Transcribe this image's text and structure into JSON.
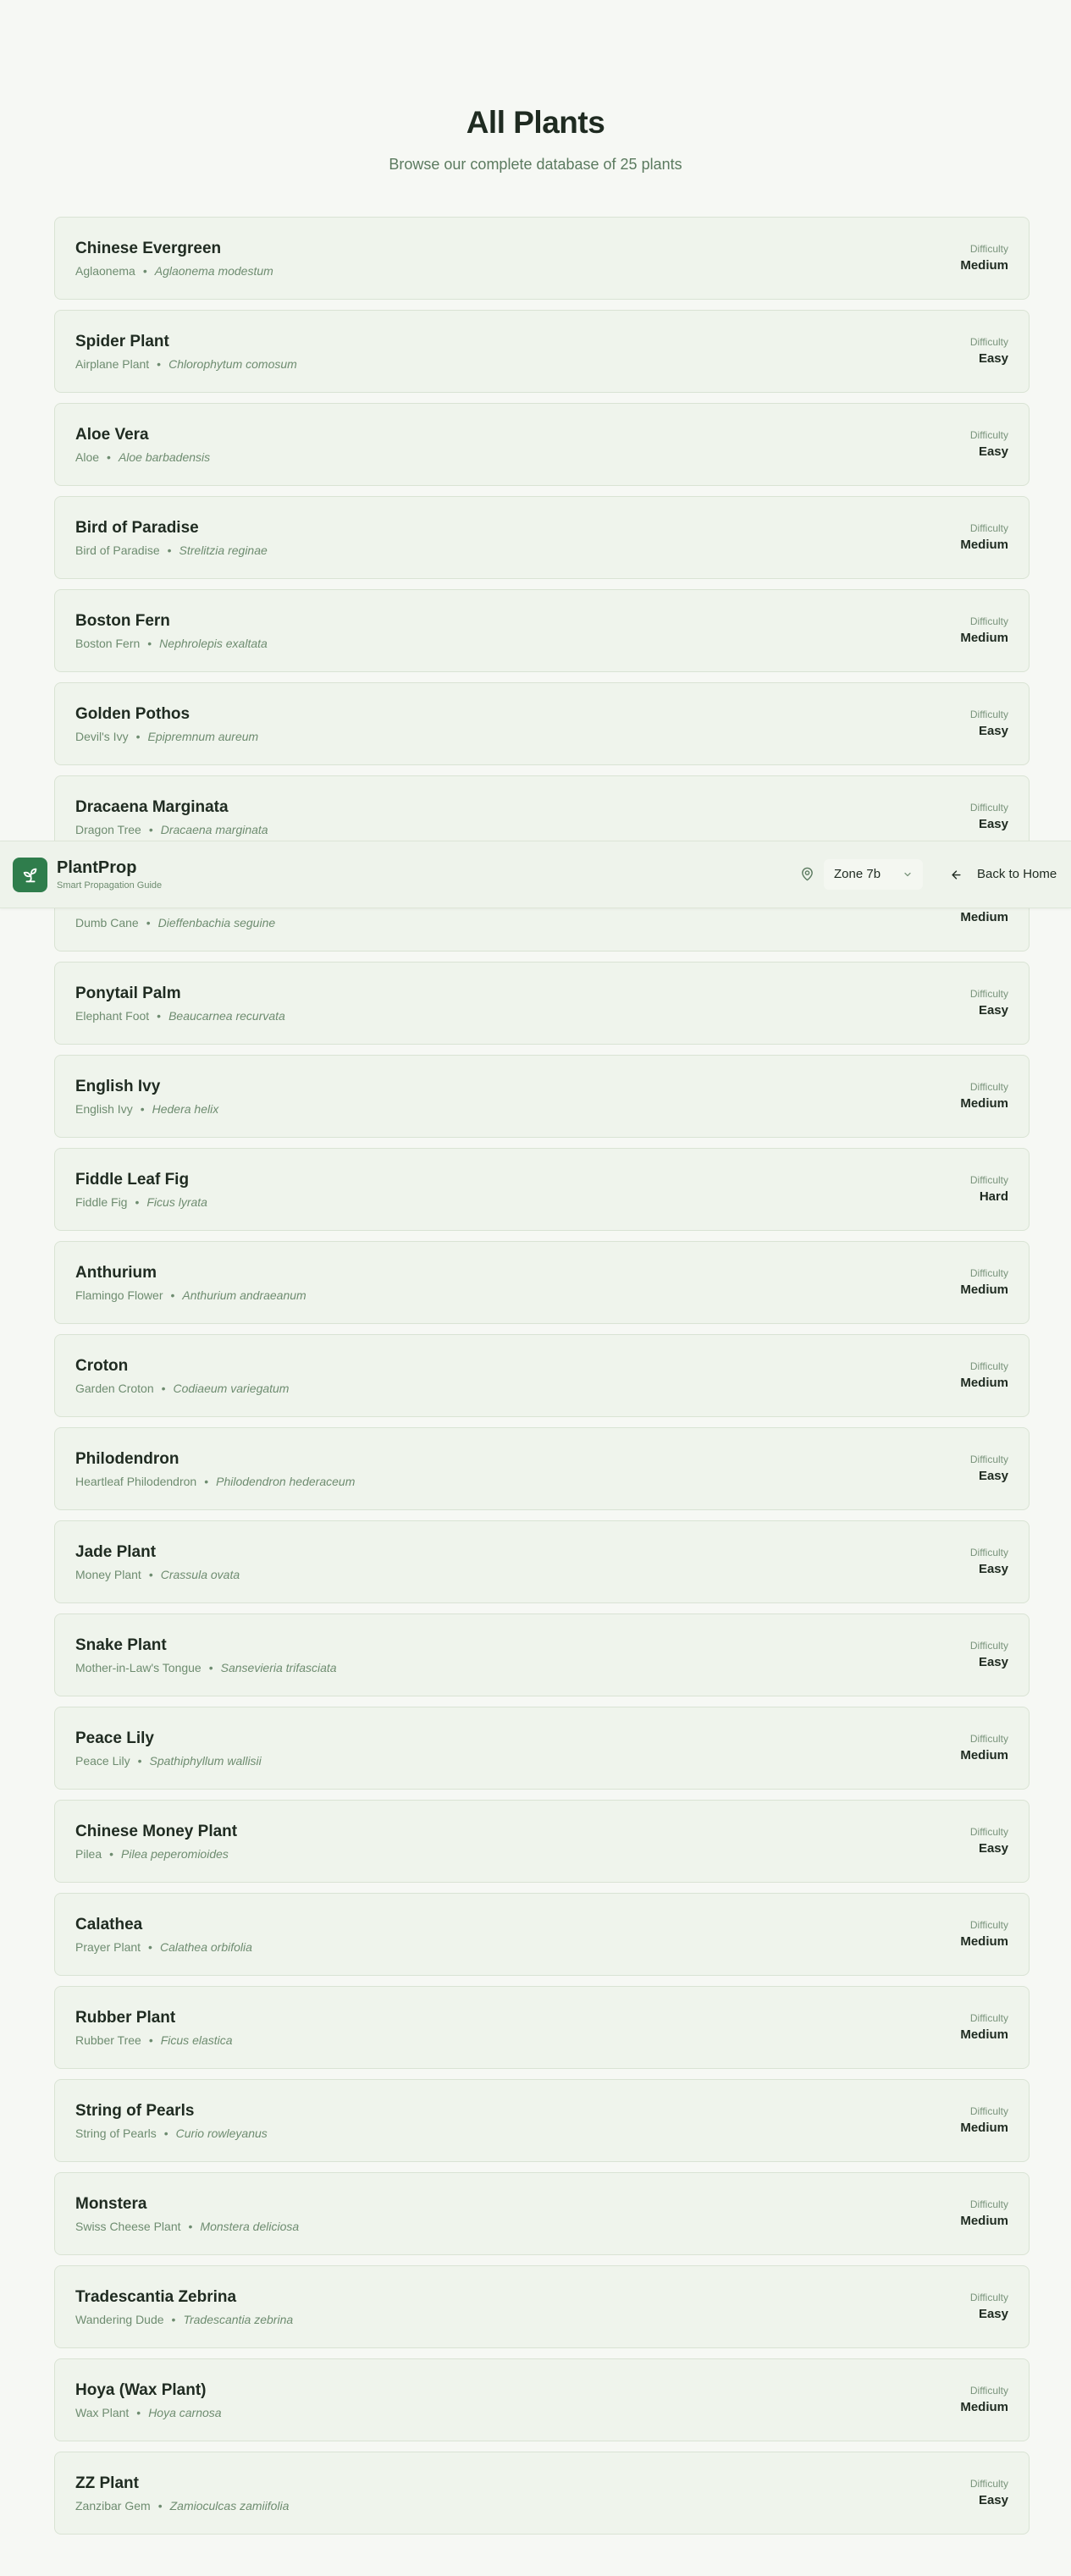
{
  "header": {
    "title": "All Plants",
    "subtitle": "Browse our complete database of 25 plants"
  },
  "navbar": {
    "brand_name": "PlantProp",
    "brand_tagline": "Smart Propagation Guide",
    "logo_icon": "sprout-icon",
    "zone_icon": "map-pin-icon",
    "zone_value": "Zone 7b",
    "back_label": "Back to Home"
  },
  "difficulty_label": "Difficulty",
  "plants": [
    {
      "name": "Chinese Evergreen",
      "common": "Aglaonema",
      "scientific": "Aglaonema modestum",
      "difficulty": "Medium"
    },
    {
      "name": "Spider Plant",
      "common": "Airplane Plant",
      "scientific": "Chlorophytum comosum",
      "difficulty": "Easy"
    },
    {
      "name": "Aloe Vera",
      "common": "Aloe",
      "scientific": "Aloe barbadensis",
      "difficulty": "Easy"
    },
    {
      "name": "Bird of Paradise",
      "common": "Bird of Paradise",
      "scientific": "Strelitzia reginae",
      "difficulty": "Medium"
    },
    {
      "name": "Boston Fern",
      "common": "Boston Fern",
      "scientific": "Nephrolepis exaltata",
      "difficulty": "Medium"
    },
    {
      "name": "Golden Pothos",
      "common": "Devil's Ivy",
      "scientific": "Epipremnum aureum",
      "difficulty": "Easy"
    },
    {
      "name": "Dracaena Marginata",
      "common": "Dragon Tree",
      "scientific": "Dracaena marginata",
      "difficulty": "Easy"
    },
    {
      "name": "",
      "common": "Dumb Cane",
      "scientific": "Dieffenbachia seguine",
      "difficulty": "Medium"
    },
    {
      "name": "Ponytail Palm",
      "common": "Elephant Foot",
      "scientific": "Beaucarnea recurvata",
      "difficulty": "Easy"
    },
    {
      "name": "English Ivy",
      "common": "English Ivy",
      "scientific": "Hedera helix",
      "difficulty": "Medium"
    },
    {
      "name": "Fiddle Leaf Fig",
      "common": "Fiddle Fig",
      "scientific": "Ficus lyrata",
      "difficulty": "Hard"
    },
    {
      "name": "Anthurium",
      "common": "Flamingo Flower",
      "scientific": "Anthurium andraeanum",
      "difficulty": "Medium"
    },
    {
      "name": "Croton",
      "common": "Garden Croton",
      "scientific": "Codiaeum variegatum",
      "difficulty": "Medium"
    },
    {
      "name": "Philodendron",
      "common": "Heartleaf Philodendron",
      "scientific": "Philodendron hederaceum",
      "difficulty": "Easy"
    },
    {
      "name": "Jade Plant",
      "common": "Money Plant",
      "scientific": "Crassula ovata",
      "difficulty": "Easy"
    },
    {
      "name": "Snake Plant",
      "common": "Mother-in-Law's Tongue",
      "scientific": "Sansevieria trifasciata",
      "difficulty": "Easy"
    },
    {
      "name": "Peace Lily",
      "common": "Peace Lily",
      "scientific": "Spathiphyllum wallisii",
      "difficulty": "Medium"
    },
    {
      "name": "Chinese Money Plant",
      "common": "Pilea",
      "scientific": "Pilea peperomioides",
      "difficulty": "Easy"
    },
    {
      "name": "Calathea",
      "common": "Prayer Plant",
      "scientific": "Calathea orbifolia",
      "difficulty": "Medium"
    },
    {
      "name": "Rubber Plant",
      "common": "Rubber Tree",
      "scientific": "Ficus elastica",
      "difficulty": "Medium"
    },
    {
      "name": "String of Pearls",
      "common": "String of Pearls",
      "scientific": "Curio rowleyanus",
      "difficulty": "Medium"
    },
    {
      "name": "Monstera",
      "common": "Swiss Cheese Plant",
      "scientific": "Monstera deliciosa",
      "difficulty": "Medium"
    },
    {
      "name": "Tradescantia Zebrina",
      "common": "Wandering Dude",
      "scientific": "Tradescantia zebrina",
      "difficulty": "Easy"
    },
    {
      "name": "Hoya (Wax Plant)",
      "common": "Wax Plant",
      "scientific": "Hoya carnosa",
      "difficulty": "Medium"
    },
    {
      "name": "ZZ Plant",
      "common": "Zanzibar Gem",
      "scientific": "Zamioculcas zamiifolia",
      "difficulty": "Easy"
    }
  ],
  "colors": {
    "background": "#f6f8f4",
    "card": "#eff4ec",
    "accent": "#2f7d4c",
    "muted_text": "#6e8c70"
  }
}
